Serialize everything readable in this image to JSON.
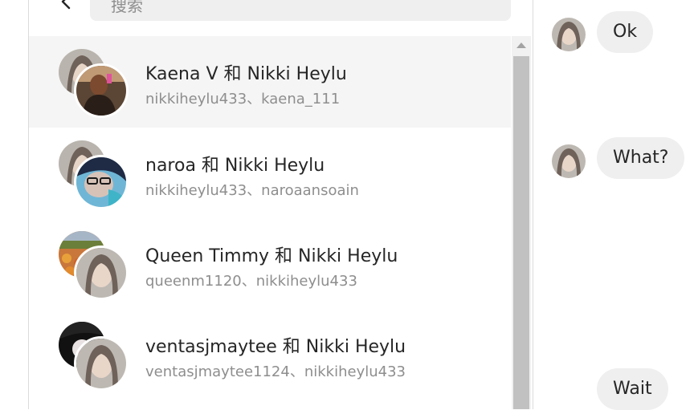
{
  "search": {
    "placeholder": "搜索"
  },
  "conversations": [
    {
      "title": "Kaena V 和 Nikki Heylu",
      "subtitle": "nikkiheylu433、kaena_111",
      "selected": true
    },
    {
      "title": "naroa 和 Nikki Heylu",
      "subtitle": "nikkiheylu433、naroaansoain",
      "selected": false
    },
    {
      "title": "Queen Timmy 和 Nikki Heylu",
      "subtitle": "queenm1120、nikkiheylu433",
      "selected": false
    },
    {
      "title": "ventasjmaytee 和 Nikki Heylu",
      "subtitle": "ventasjmaytee1124、nikkiheylu433",
      "selected": false
    }
  ],
  "messages": [
    {
      "text": "Ok"
    },
    {
      "text": "What?"
    },
    {
      "text": "Wait"
    }
  ],
  "colors": {
    "selected_row": "#f5f5f5",
    "bubble": "#efefef",
    "secondary_text": "#8e8e8e",
    "primary_text": "#262626"
  }
}
